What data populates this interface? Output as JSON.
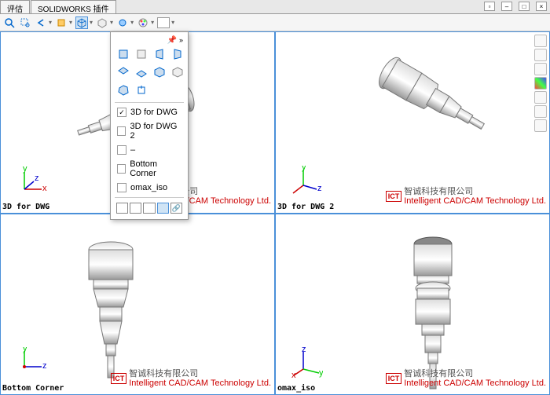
{
  "tabs": {
    "t1": "评估",
    "t2": "SOLIDWORKS 插件"
  },
  "dropdown": {
    "item1": "3D for DWG",
    "item2": "3D for DWG 2",
    "dash": "–",
    "item3": "Bottom Corner",
    "item4": "omax_iso"
  },
  "viewports": {
    "v1": "3D for DWG",
    "v2": "3D for DWG 2",
    "v3": "Bottom Corner",
    "v4": "omax_iso"
  },
  "logo": {
    "badge": "ICT",
    "cn": "智诚科技有限公司",
    "en": "Intelligent CAD/CAM Technology Ltd."
  },
  "axes": {
    "x": "x",
    "y": "y",
    "z": "z"
  }
}
